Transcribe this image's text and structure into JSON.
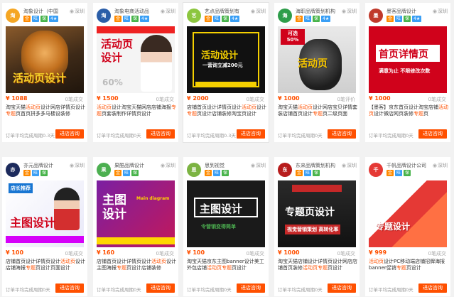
{
  "colors": {
    "accent": "#ff5000",
    "badge_blue": "#3a9ff5",
    "badge_green": "#47b34a",
    "badge_orange": "#ff8a00"
  },
  "cards": [
    {
      "shop_name": "淘象设计（中国",
      "location": "深圳",
      "badges": [
        "金",
        "旺",
        "保",
        "4★"
      ],
      "thumb_text": "活动页设计",
      "thumb_sub": "",
      "price": "¥ 1088",
      "sales": "0笔成交",
      "desc_parts": [
        "淘宝天猫",
        "活动页",
        "设计网店详情页设计",
        "专题",
        "页首页拼多多马楼设装修"
      ],
      "note": "订单平均完成周期0.3天",
      "button": "进店咨询"
    },
    {
      "shop_name": "淘象电商活动品",
      "location": "深圳",
      "badges": [
        "金",
        "旺",
        "保",
        "4★"
      ],
      "thumb_text": "活动页\n设计",
      "thumb_sub": "60%",
      "price": "¥ 1500",
      "sales": "0笔成交",
      "desc_parts": [
        "",
        "活动页",
        "设计淘宝天猫网店店铺海报",
        "专题",
        "页套装制作详情页设计"
      ],
      "note": "订单平均完成周期0天",
      "button": "进店咨询"
    },
    {
      "shop_name": "艺点品牌策划有",
      "location": "深圳",
      "badges": [
        "金",
        "旺",
        "保",
        "4★"
      ],
      "thumb_text": "活动设计",
      "thumb_sub": "一营询立减200元",
      "price": "¥ 2000",
      "sales": "0笔成交",
      "desc_parts": [
        "店铺首页设计详情页设计",
        "活动页",
        "设计",
        "专题",
        "页设计店铺装修淘宝页设计"
      ],
      "note": "订单平均完成周期0.3天",
      "button": "进店咨询"
    },
    {
      "shop_name": "海职品牌策划机构",
      "location": "深圳",
      "badges": [
        "金",
        "旺",
        "保",
        "4★"
      ],
      "thumb_text": "活动页",
      "thumb_sub": "可选 50%",
      "price": "¥ 1000",
      "sales": "0笔评价",
      "desc_parts": [
        "淘宝天猫",
        "活动页",
        "设计网店宝贝详情套装店铺首页设计",
        "专题",
        "页二级页面"
      ],
      "note": "订单平均完成周期0天",
      "button": "进店咨询"
    },
    {
      "shop_name": "墨客品牌设计",
      "location": "深圳",
      "badges": [
        "金",
        "旺",
        "保",
        "4★"
      ],
      "thumb_text": "首页详情页",
      "thumb_sub": "满意为止 不限修改次数",
      "price": "¥ 1000",
      "sales": "0笔成交",
      "desc_parts": [
        "【墨客】京东首页设计淘宝店铺",
        "活动页",
        "设计微店网页装修",
        "专题",
        "页"
      ],
      "note": "订单平均完成周期0天",
      "button": "进店咨询"
    },
    {
      "shop_name": "亦元品牌设计",
      "location": "深圳",
      "badges": [
        "金",
        "旺",
        "保"
      ],
      "thumb_text": "主图设计",
      "thumb_sub": "店长推荐",
      "price": "¥ 100",
      "sales": "0笔成交",
      "desc_parts": [
        "店铺首页设计详情页设计",
        "活动页",
        "设计店铺海报",
        "专题",
        "页设计页面设计"
      ],
      "note": "订单平均完成周期0天",
      "button": "进店咨询"
    },
    {
      "shop_name": "果酷品牌设计",
      "location": "深圳",
      "badges": [
        "金",
        "旺",
        "保"
      ],
      "thumb_text": "主图\n设计",
      "thumb_sub": "Main diagram",
      "price": "¥ 160",
      "sales": "0笔成交",
      "desc_parts": [
        "店铺首页设计详情页设计",
        "活动页",
        "设计主图海报",
        "专题",
        "页设计店铺装修"
      ],
      "note": "订单平均完成周期0天",
      "button": "进店咨询"
    },
    {
      "shop_name": "思到视觉",
      "location": "深圳",
      "badges": [
        "金",
        "旺",
        "保"
      ],
      "thumb_text": "主图设计",
      "thumb_sub": "令营销变得简单",
      "price": "¥ 100",
      "sales": "0笔成交",
      "desc_parts": [
        "淘宝天猫京东主图banner设计美工外包店铺",
        "活动页",
        "专题",
        "页设计",
        ""
      ],
      "note": "订单平均完成周期0天",
      "button": "进店咨询"
    },
    {
      "shop_name": "东来品牌策划机构",
      "location": "深圳",
      "badges": [
        "金",
        "旺",
        "保"
      ],
      "thumb_text": "专题页设计",
      "thumb_sub": "视觉营销策划 高转化率",
      "price": "¥ 1000",
      "sales": "0笔成交",
      "desc_parts": [
        "淘宝天猫店铺设计详情页设计网店店铺首页装修",
        "活动页",
        "",
        "专题",
        "页设计"
      ],
      "note": "订单平均完成周期0天",
      "button": "进店咨询"
    },
    {
      "shop_name": "千帆品牌设计公司",
      "location": "深圳",
      "badges": [
        "金",
        "旺",
        "保"
      ],
      "thumb_text": "专题设计",
      "thumb_sub": "",
      "price": "¥ 999",
      "sales": "0笔成交",
      "desc_parts": [
        "",
        "活动页",
        "设计PC移动端店铺招牌海报banner促销",
        "专题",
        "页设计"
      ],
      "note": "订单平均完成周期0天",
      "button": "进店咨询"
    }
  ]
}
